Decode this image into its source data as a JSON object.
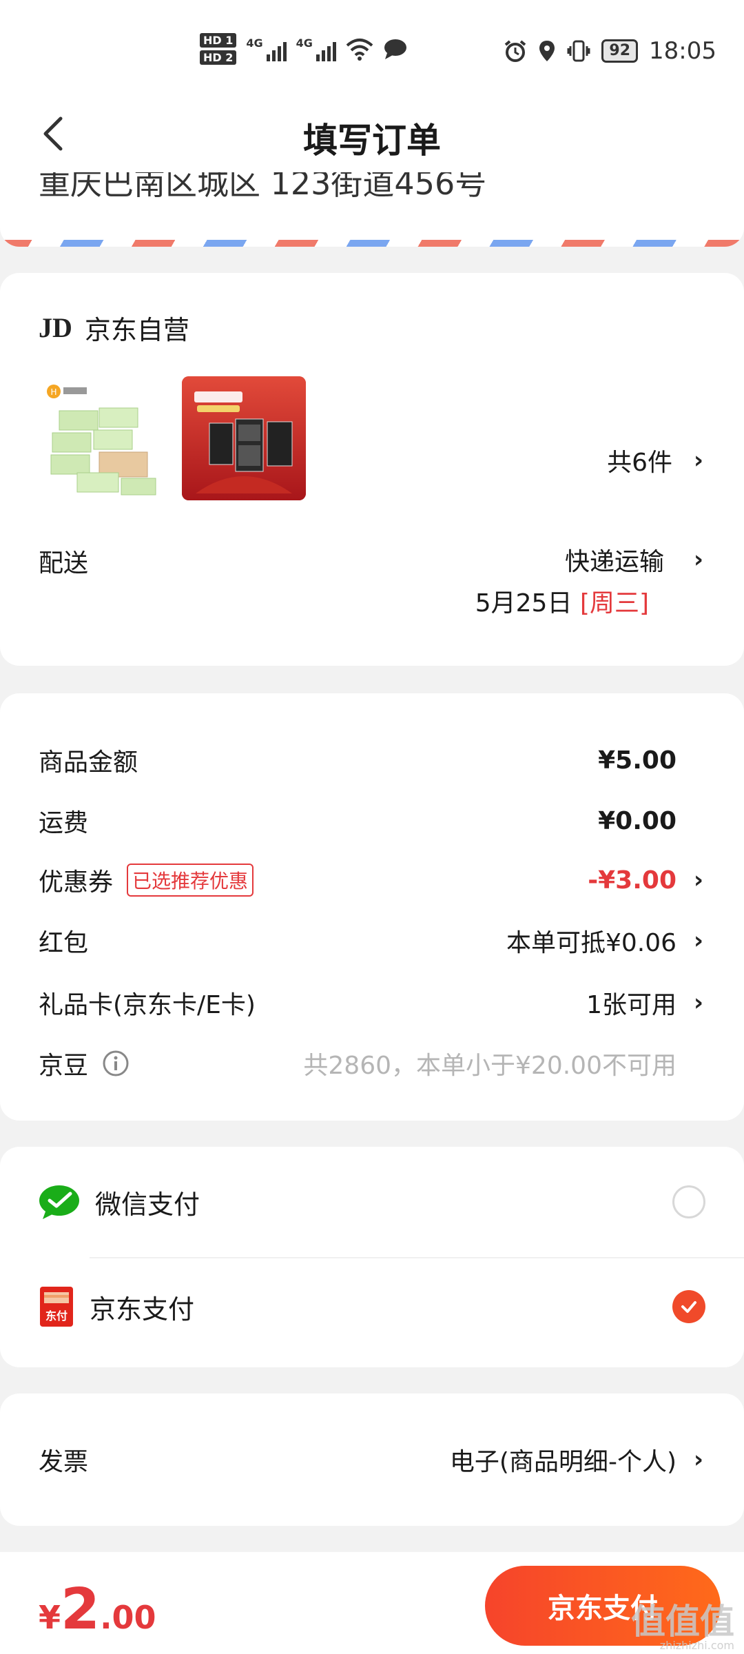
{
  "status_bar": {
    "hd1": "HD 1",
    "hd2": "HD 2",
    "net1": "4G",
    "net2": "4G",
    "battery": "92",
    "time": "18:05"
  },
  "header": {
    "title": "填写订单"
  },
  "address": {
    "text": "重庆巴南区城区 123街道456号"
  },
  "shop": {
    "logo": "JD",
    "name": "京东自营",
    "item_count": "共6件",
    "products": [
      "product-tissue-image",
      "product-cabinet-image"
    ],
    "delivery_label": "配送",
    "delivery_method": "快递运输",
    "delivery_date": "5月25日",
    "delivery_weekday": "[周三]"
  },
  "prices": {
    "rows": [
      {
        "label": "商品金额",
        "value": "¥5.00"
      },
      {
        "label": "运费",
        "value": "¥0.00"
      },
      {
        "label": "优惠券",
        "tag": "已选推荐优惠",
        "value": "-¥3.00"
      },
      {
        "label": "红包",
        "value": "本单可抵¥0.06"
      },
      {
        "label": "礼品卡(京东卡/E卡)",
        "value": "1张可用"
      },
      {
        "label": "京豆",
        "value": "共2860，本单小于¥20.00不可用"
      }
    ]
  },
  "payment": {
    "options": [
      {
        "label": "微信支付",
        "selected": false
      },
      {
        "label": "京东支付",
        "selected": true
      }
    ],
    "jd_icon_text": "东付"
  },
  "invoice": {
    "label": "发票",
    "value": "电子(商品明细-个人)"
  },
  "footer": {
    "currency": "¥",
    "total_int": "2",
    "total_dec": ".00",
    "pay_button": "京东支付",
    "watermark": "值值值",
    "watermark_url": "zhizhizhi.com"
  },
  "colors": {
    "accent": "#e4393c",
    "button": "#f6442b",
    "wechat": "#1aad19"
  }
}
